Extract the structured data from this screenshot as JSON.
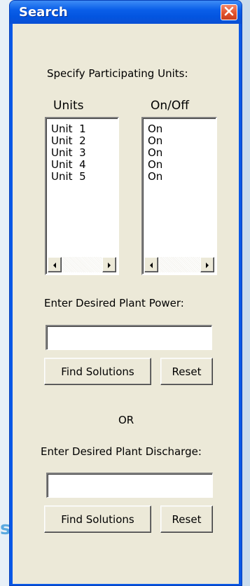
{
  "window": {
    "title": "Search"
  },
  "main": {
    "instruction": "Specify Participating Units:",
    "units_header": "Units",
    "onoff_header": "On/Off",
    "units": [
      "Unit  1",
      "Unit  2",
      "Unit  3",
      "Unit  4",
      "Unit  5"
    ],
    "onoff": [
      "On",
      "On",
      "On",
      "On",
      "On"
    ],
    "power_label": "Enter Desired Plant Power:",
    "power_value": "",
    "find_label": "Find Solutions",
    "reset_label": "Reset",
    "or_label": "OR",
    "discharge_label": "Enter Desired Plant Discharge:",
    "discharge_value": ""
  },
  "background": {
    "edge_letter": "s"
  },
  "colors": {
    "titlebar": "#0a5ee8",
    "client": "#ece9d8",
    "close": "#e2532e",
    "accent_letter": "#5aa9e0"
  }
}
